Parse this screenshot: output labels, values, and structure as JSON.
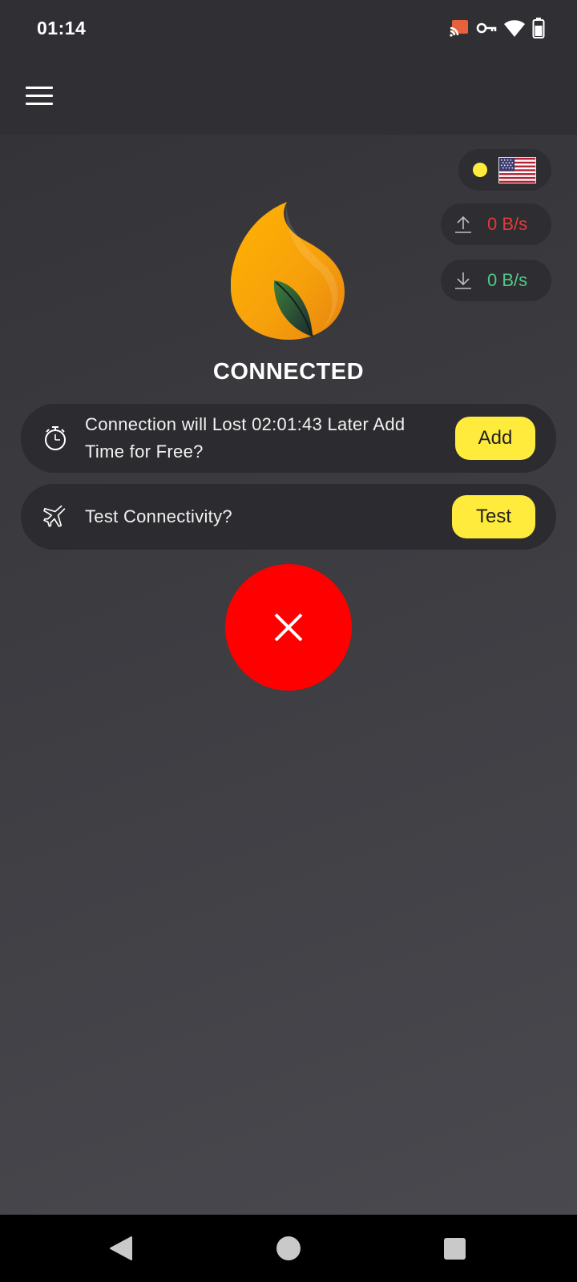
{
  "status_bar": {
    "time": "01:14",
    "icons": [
      "cast-icon",
      "vpn-key-icon",
      "wifi-icon",
      "battery-icon"
    ]
  },
  "app_bar": {
    "menu_icon": "hamburger-menu-icon"
  },
  "server": {
    "indicator_color": "#ffeb3b",
    "flag": "us-flag-icon"
  },
  "traffic": {
    "upload_speed": "0 B/s",
    "download_speed": "0 B/s",
    "upload_color": "#e53935",
    "download_color": "#4fc98a"
  },
  "connection": {
    "status": "CONNECTED"
  },
  "time_card": {
    "icon": "stopwatch-icon",
    "text": "Connection will Lost 02:01:43 Later Add Time for Free?",
    "button_label": "Add"
  },
  "test_card": {
    "icon": "airplane-icon",
    "text": "Test Connectivity?",
    "button_label": "Test"
  },
  "disconnect": {
    "icon": "close-icon",
    "color": "#ff0000"
  },
  "colors": {
    "accent": "#ffeb3b",
    "card_bg": "#2c2c30"
  },
  "nav_bar": {
    "icons": [
      "back-icon",
      "home-icon",
      "recents-icon"
    ]
  }
}
